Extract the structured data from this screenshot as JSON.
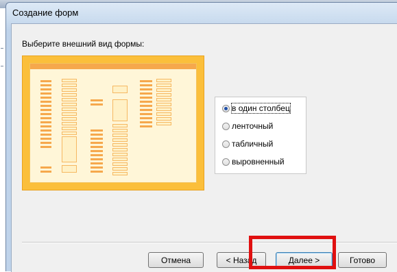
{
  "window": {
    "title": "Создание форм"
  },
  "prompt": "Выберите внешний вид формы:",
  "layout_options": [
    {
      "label": "в один столбец",
      "selected": true
    },
    {
      "label": "ленточный",
      "selected": false
    },
    {
      "label": "табличный",
      "selected": false
    },
    {
      "label": "выровненный",
      "selected": false
    }
  ],
  "buttons": {
    "cancel": "Отмена",
    "back": "< Назад",
    "next": "Далее >",
    "finish": "Готово"
  },
  "colors": {
    "preview_accent": "#fbbf3b",
    "highlight": "#e01010"
  }
}
